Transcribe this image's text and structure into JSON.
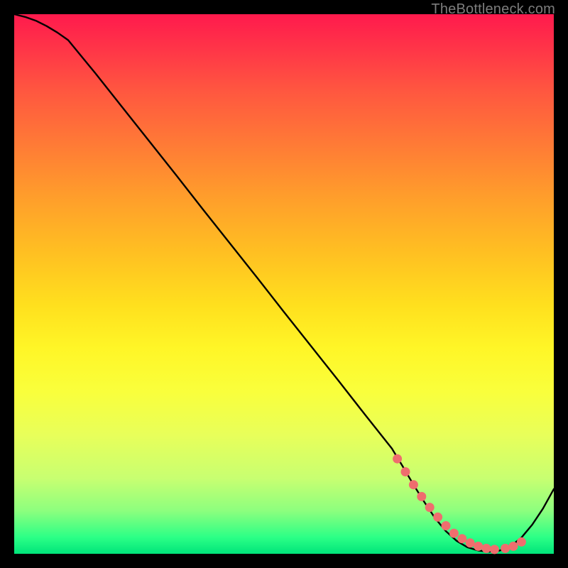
{
  "watermark": "TheBottleneck.com",
  "colors": {
    "background": "#000000",
    "gradient_top": "#ff1a4d",
    "gradient_mid": "#ffe01e",
    "gradient_bottom": "#00e47a",
    "curve_stroke": "#000000",
    "marker_fill": "#ef6e6e",
    "marker_stroke": "#b84c4c",
    "watermark": "#7d7d7d"
  },
  "chart_data": {
    "type": "line",
    "title": "",
    "xlabel": "",
    "ylabel": "",
    "xlim": [
      0,
      100
    ],
    "ylim": [
      0,
      100
    ],
    "x": [
      0,
      2,
      4,
      6,
      8,
      10,
      15,
      20,
      25,
      30,
      35,
      40,
      45,
      50,
      55,
      60,
      65,
      70,
      72,
      74,
      76,
      78,
      80,
      82,
      84,
      86,
      88,
      90,
      92,
      94,
      96,
      98,
      100
    ],
    "y": [
      100,
      99.5,
      98.8,
      97.8,
      96.6,
      95.2,
      89.1,
      82.8,
      76.5,
      70.2,
      63.8,
      57.5,
      51.2,
      44.8,
      38.5,
      32.2,
      25.8,
      19.5,
      16.2,
      12.8,
      9.6,
      6.6,
      4.2,
      2.4,
      1.2,
      0.6,
      0.4,
      0.6,
      1.4,
      3.0,
      5.4,
      8.4,
      12.0
    ],
    "markers_x": [
      71,
      72.5,
      74,
      75.5,
      77,
      78.5,
      80,
      81.5,
      83,
      84.5,
      86,
      87.5,
      89,
      91,
      92.5,
      94
    ],
    "markers_y": [
      17.6,
      15.2,
      12.8,
      10.6,
      8.6,
      6.8,
      5.2,
      3.8,
      2.8,
      2.0,
      1.4,
      1.0,
      0.8,
      1.0,
      1.4,
      2.2
    ]
  }
}
